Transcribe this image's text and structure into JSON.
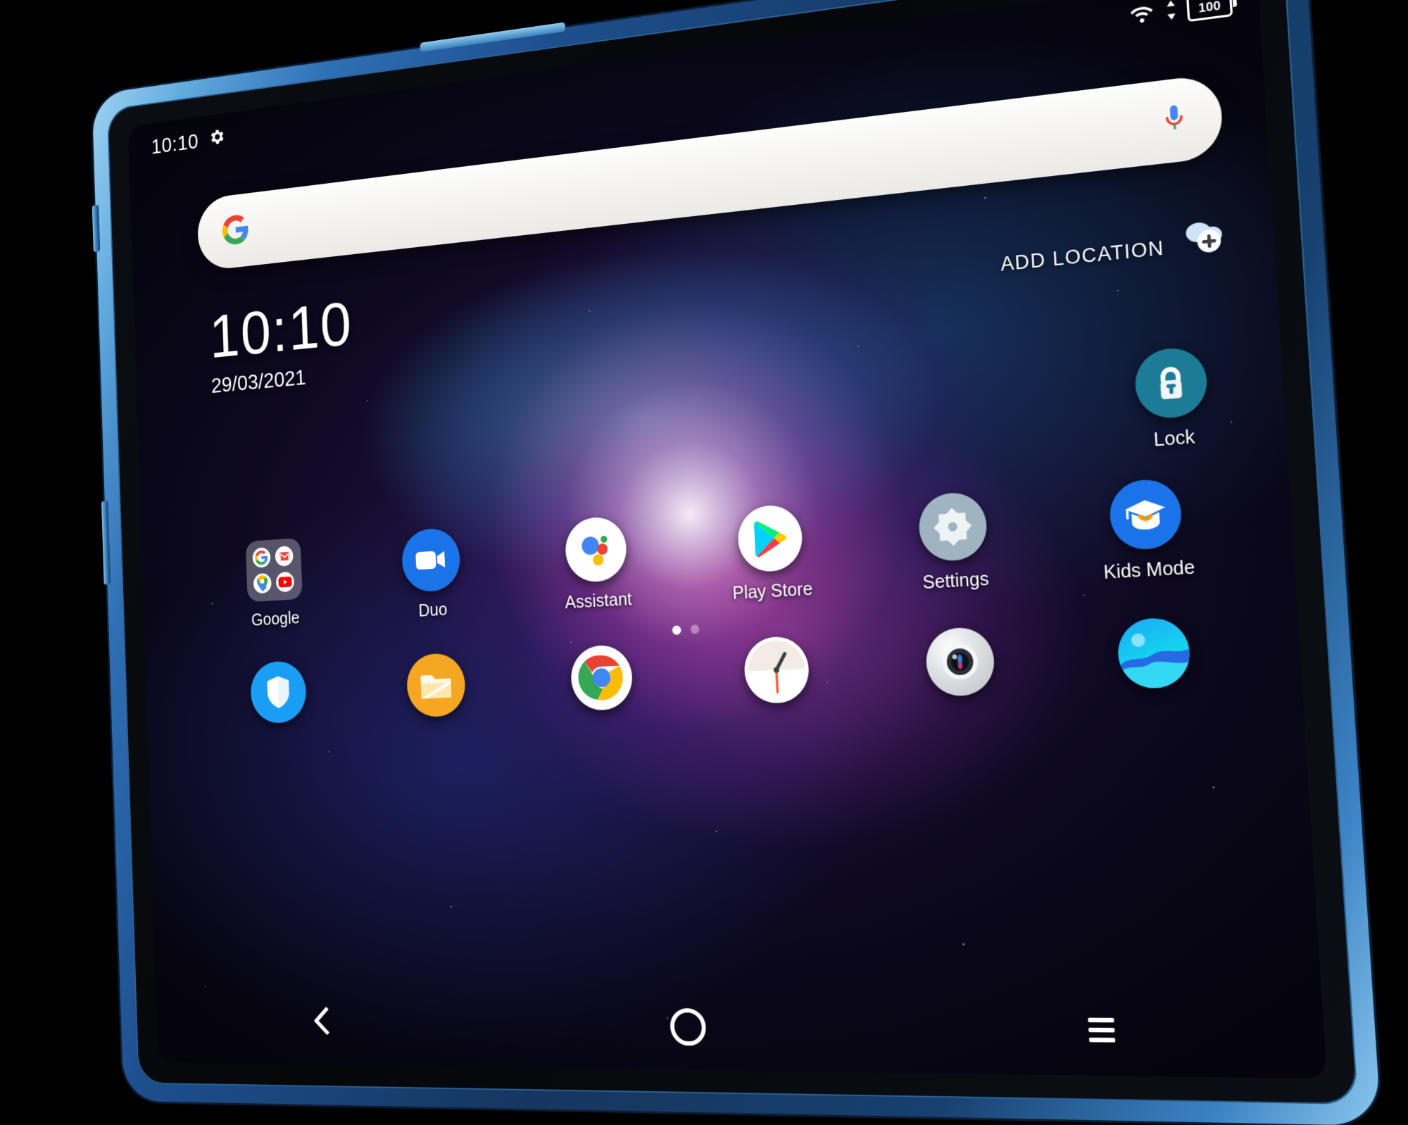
{
  "device": {
    "type": "android-tablet",
    "frame_color": "#2f6fb5",
    "orientation": "landscape"
  },
  "status_bar": {
    "time": "10:10",
    "settings_icon": "gear-icon",
    "wifi_icon": "wifi-icon",
    "battery_icon": "battery-icon",
    "battery_level": "100"
  },
  "search": {
    "logo": "google-g-icon",
    "value": "",
    "placeholder": "",
    "mic_icon": "microphone-icon"
  },
  "clock_widget": {
    "time": "10:10",
    "date": "29/03/2021"
  },
  "weather_widget": {
    "add_location_label": "ADD LOCATION",
    "icon": "cloud-plus-icon"
  },
  "lock_shortcut": {
    "label": "Lock",
    "icon": "padlock-icon",
    "color": "#1c7b96"
  },
  "home_grid": {
    "row1": [
      {
        "label": "Google",
        "icon": "google-folder-icon",
        "type": "folder",
        "items": [
          "google-icon",
          "gmail-icon",
          "maps-icon",
          "youtube-icon"
        ]
      },
      {
        "label": "Duo",
        "icon": "duo-icon",
        "color": "#1a73e8"
      },
      {
        "label": "Assistant",
        "icon": "assistant-icon",
        "color": "#ffffff"
      },
      {
        "label": "Play Store",
        "icon": "play-store-icon",
        "color": "#ffffff"
      },
      {
        "label": "Settings",
        "icon": "settings-gear-icon",
        "color": "#94a7b5"
      },
      {
        "label": "Kids Mode",
        "icon": "graduation-cap-icon",
        "color": "#1a73e8"
      }
    ],
    "row2": [
      {
        "label": "",
        "icon": "security-shield-icon",
        "color": "#1a9ef5"
      },
      {
        "label": "",
        "icon": "files-folder-icon",
        "color": "#f5a623"
      },
      {
        "label": "",
        "icon": "chrome-icon",
        "color": "#ffffff"
      },
      {
        "label": "",
        "icon": "clock-icon",
        "color": "#ffffff"
      },
      {
        "label": "",
        "icon": "camera-icon",
        "color": "#e8e8e8"
      },
      {
        "label": "",
        "icon": "gallery-icon",
        "color": "#20b4f0"
      }
    ]
  },
  "page_indicator": {
    "total": 2,
    "active": 1
  },
  "nav_bar": {
    "back_label": "Back",
    "home_label": "Home",
    "recents_label": "Recents",
    "back_icon": "chevron-left-icon",
    "home_icon": "circle-icon",
    "recents_icon": "hamburger-icon"
  },
  "colors": {
    "google_blue": "#4285F4",
    "google_red": "#EA4335",
    "google_yellow": "#FBBC05",
    "google_green": "#34A853",
    "accent_blue": "#1a73e8"
  }
}
